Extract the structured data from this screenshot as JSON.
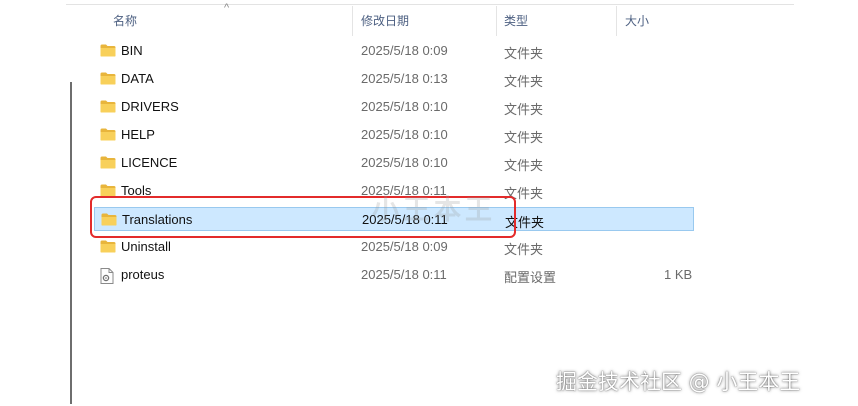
{
  "columns": {
    "name": "名称",
    "modified": "修改日期",
    "type": "类型",
    "size": "大小"
  },
  "sort_indicator": "^",
  "rows": [
    {
      "name": "BIN",
      "modified": "2025/5/18 0:09",
      "type": "文件夹",
      "size": "",
      "icon": "folder-icon"
    },
    {
      "name": "DATA",
      "modified": "2025/5/18 0:13",
      "type": "文件夹",
      "size": "",
      "icon": "folder-icon"
    },
    {
      "name": "DRIVERS",
      "modified": "2025/5/18 0:10",
      "type": "文件夹",
      "size": "",
      "icon": "folder-icon"
    },
    {
      "name": "HELP",
      "modified": "2025/5/18 0:10",
      "type": "文件夹",
      "size": "",
      "icon": "folder-icon"
    },
    {
      "name": "LICENCE",
      "modified": "2025/5/18 0:10",
      "type": "文件夹",
      "size": "",
      "icon": "folder-icon"
    },
    {
      "name": "Tools",
      "modified": "2025/5/18 0:11",
      "type": "文件夹",
      "size": "",
      "icon": "folder-icon"
    },
    {
      "name": "Translations",
      "modified": "2025/5/18 0:11",
      "type": "文件夹",
      "size": "",
      "icon": "folder-icon",
      "selected": true
    },
    {
      "name": "Uninstall",
      "modified": "2025/5/18 0:09",
      "type": "文件夹",
      "size": "",
      "icon": "folder-icon"
    },
    {
      "name": "proteus",
      "modified": "2025/5/18 0:11",
      "type": "配置设置",
      "size": "1 KB",
      "icon": "config-file-icon"
    }
  ],
  "watermark_center": "小王本王",
  "watermark": "掘金技术社区 @ 小王本王",
  "colors": {
    "selection": "#cde8ff",
    "selection_border": "#99c9ef",
    "highlight": "#e32b2b",
    "folder": "#f8d05a"
  }
}
